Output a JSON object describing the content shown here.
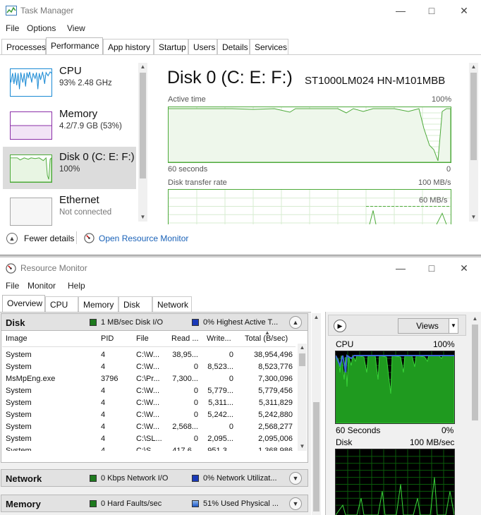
{
  "task_manager": {
    "title": "Task Manager",
    "menu": [
      "File",
      "Options",
      "View"
    ],
    "tabs": [
      "Processes",
      "Performance",
      "App history",
      "Startup",
      "Users",
      "Details",
      "Services"
    ],
    "active_tab": "Performance",
    "sidebar": [
      {
        "name": "CPU",
        "sub": "93%  2.48 GHz",
        "color": "#1a8ad4"
      },
      {
        "name": "Memory",
        "sub": "4.2/7.9 GB (53%)",
        "color": "#8b2fa8"
      },
      {
        "name": "Disk 0 (C: E: F:)",
        "sub": "100%",
        "color": "#4daa3a"
      },
      {
        "name": "Ethernet",
        "sub": "Not connected",
        "color": "#a7a7a7"
      }
    ],
    "detail": {
      "title": "Disk 0 (C: E: F:)",
      "model": "ST1000LM024 HN-M101MBB",
      "active_time_label": "Active time",
      "active_time_max": "100%",
      "seconds_label": "60 seconds",
      "zero_label": "0",
      "transfer_label": "Disk transfer rate",
      "transfer_max": "100 MB/s",
      "transfer_mid": "60 MB/s"
    },
    "footer": {
      "fewer_details": "Fewer details",
      "open_resource_monitor": "Open Resource Monitor"
    }
  },
  "resource_monitor": {
    "title": "Resource Monitor",
    "menu": [
      "File",
      "Monitor",
      "Help"
    ],
    "tabs": [
      "Overview",
      "CPU",
      "Memory",
      "Disk",
      "Network"
    ],
    "active_tab": "Overview",
    "disk": {
      "heading": "Disk",
      "io": "1 MB/sec Disk I/O",
      "active": "0% Highest Active T...",
      "columns": [
        "Image",
        "PID",
        "File",
        "Read ...",
        "Write...",
        "Total (B/sec)"
      ],
      "rows": [
        [
          "System",
          "4",
          "C:\\W...",
          "38,95...",
          "0",
          "38,954,496"
        ],
        [
          "System",
          "4",
          "C:\\W...",
          "0",
          "8,523...",
          "8,523,776"
        ],
        [
          "MsMpEng.exe",
          "3796",
          "C:\\Pr...",
          "7,300...",
          "0",
          "7,300,096"
        ],
        [
          "System",
          "4",
          "C:\\W...",
          "0",
          "5,779...",
          "5,779,456"
        ],
        [
          "System",
          "4",
          "C:\\W...",
          "0",
          "5,311...",
          "5,311,829"
        ],
        [
          "System",
          "4",
          "C:\\W...",
          "0",
          "5,242...",
          "5,242,880"
        ],
        [
          "System",
          "4",
          "C:\\W...",
          "2,568...",
          "0",
          "2,568,277"
        ],
        [
          "System",
          "4",
          "C:\\SL...",
          "0",
          "2,095...",
          "2,095,006"
        ],
        [
          "System",
          "4",
          "C:\\S...",
          "417,6...",
          "951,3...",
          "1,368,986"
        ]
      ]
    },
    "network": {
      "heading": "Network",
      "io": "0 Kbps Network I/O",
      "util": "0% Network Utilizat..."
    },
    "memory": {
      "heading": "Memory",
      "faults": "0 Hard Faults/sec",
      "used": "51% Used Physical ..."
    },
    "right": {
      "views": "Views",
      "cpu_label": "CPU",
      "cpu_max": "100%",
      "seconds": "60 Seconds",
      "cpu_min": "0%",
      "disk_label": "Disk",
      "disk_max": "100 MB/sec"
    }
  }
}
